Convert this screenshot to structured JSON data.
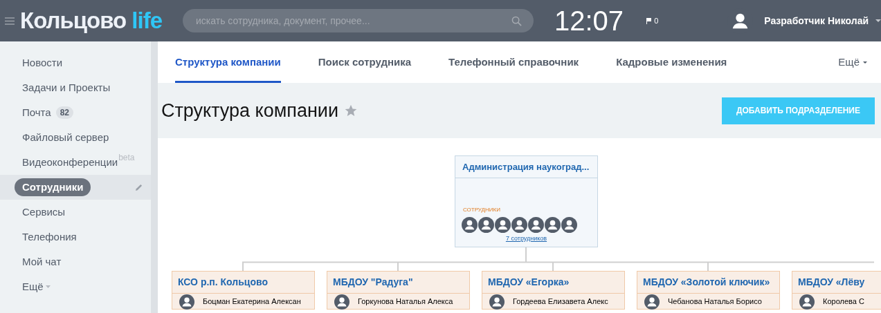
{
  "header": {
    "logo": {
      "main": "Кольцово",
      "accent": "life"
    },
    "search": {
      "placeholder": "искать сотрудника, документ, прочее..."
    },
    "clock": "12:07",
    "flags": "0",
    "user": {
      "name": "Разработчик Николай"
    }
  },
  "sidebar": {
    "items": [
      {
        "label": "Новости",
        "selected": false
      },
      {
        "label": "Задачи и Проекты",
        "selected": false
      },
      {
        "label": "Почта",
        "selected": false,
        "badge": "82"
      },
      {
        "label": "Файловый сервер",
        "selected": false
      },
      {
        "label": "Видеоконференции",
        "selected": false,
        "tag": "beta"
      },
      {
        "label": "Сотрудники",
        "selected": true
      },
      {
        "label": "Сервисы",
        "selected": false
      },
      {
        "label": "Телефония",
        "selected": false
      },
      {
        "label": "Мой чат",
        "selected": false
      },
      {
        "label": "Ещё",
        "selected": false,
        "kind": "more"
      }
    ]
  },
  "tabs": [
    {
      "label": "Структура компании",
      "selected": true
    },
    {
      "label": "Поиск сотрудника",
      "selected": false
    },
    {
      "label": "Телефонный справочник",
      "selected": false
    },
    {
      "label": "Кадровые изменения",
      "selected": false
    }
  ],
  "tabs_more": "Ещё",
  "page": {
    "title": "Структура компании",
    "add_button": "ДОБАВИТЬ ПОДРАЗДЕЛЕНИЕ"
  },
  "structure": {
    "root": {
      "title": "Администрация наукоград...",
      "label": "СОТРУДНИКИ",
      "link": "7 сотрудников"
    },
    "children": [
      {
        "title": "КСО р.п. Кольцово",
        "member": "Боцман Екатерина Алексан"
      },
      {
        "title": "МБДОУ \"Радуга\"",
        "member": "Горкунова Наталья Алекса"
      },
      {
        "title": "МБДОУ «Егорка»",
        "member": "Гордеева Елизавета Алекс"
      },
      {
        "title": "МБДОУ «Золотой ключик»",
        "member": "Чебанова Наталья Борисо"
      },
      {
        "title": "МБДОУ «Лёву",
        "member": "Королева С"
      }
    ]
  }
}
